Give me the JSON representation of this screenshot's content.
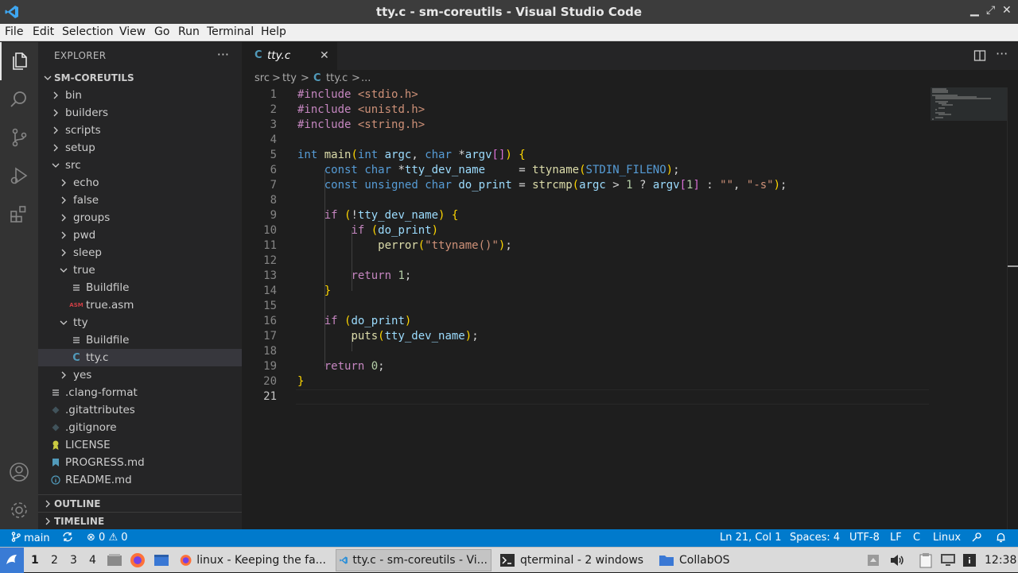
{
  "window": {
    "title": "tty.c - sm-coreutils - Visual Studio Code"
  },
  "menu": [
    "File",
    "Edit",
    "Selection",
    "View",
    "Go",
    "Run",
    "Terminal",
    "Help"
  ],
  "sidebar": {
    "header": "EXPLORER",
    "more": "···",
    "project": "SM-COREUTILS",
    "tree": [
      {
        "label": "bin",
        "kind": "folder",
        "expanded": false,
        "depth": 0
      },
      {
        "label": "builders",
        "kind": "folder",
        "expanded": false,
        "depth": 0
      },
      {
        "label": "scripts",
        "kind": "folder",
        "expanded": false,
        "depth": 0
      },
      {
        "label": "setup",
        "kind": "folder",
        "expanded": false,
        "depth": 0
      },
      {
        "label": "src",
        "kind": "folder",
        "expanded": true,
        "depth": 0
      },
      {
        "label": "echo",
        "kind": "folder",
        "expanded": false,
        "depth": 1
      },
      {
        "label": "false",
        "kind": "folder",
        "expanded": false,
        "depth": 1
      },
      {
        "label": "groups",
        "kind": "folder",
        "expanded": false,
        "depth": 1
      },
      {
        "label": "pwd",
        "kind": "folder",
        "expanded": false,
        "depth": 1
      },
      {
        "label": "sleep",
        "kind": "folder",
        "expanded": false,
        "depth": 1
      },
      {
        "label": "true",
        "kind": "folder",
        "expanded": true,
        "depth": 1
      },
      {
        "label": "Buildfile",
        "kind": "file-lines",
        "depth": 2
      },
      {
        "label": "true.asm",
        "kind": "file-asm",
        "depth": 2
      },
      {
        "label": "tty",
        "kind": "folder",
        "expanded": true,
        "depth": 1
      },
      {
        "label": "Buildfile",
        "kind": "file-lines",
        "depth": 2
      },
      {
        "label": "tty.c",
        "kind": "file-c",
        "depth": 2,
        "selected": true
      },
      {
        "label": "yes",
        "kind": "folder",
        "expanded": false,
        "depth": 1
      },
      {
        "label": ".clang-format",
        "kind": "file-lines",
        "depth": 0
      },
      {
        "label": ".gitattributes",
        "kind": "file-git",
        "depth": 0
      },
      {
        "label": ".gitignore",
        "kind": "file-git",
        "depth": 0
      },
      {
        "label": "LICENSE",
        "kind": "file-license",
        "depth": 0
      },
      {
        "label": "PROGRESS.md",
        "kind": "file-md",
        "depth": 0
      },
      {
        "label": "README.md",
        "kind": "file-info",
        "depth": 0
      }
    ],
    "outline": "OUTLINE",
    "timeline": "TIMELINE"
  },
  "editor": {
    "tab": {
      "icon": "C",
      "label": "tty.c",
      "close": "✕"
    },
    "breadcrumb": [
      "src",
      ">",
      "tty",
      ">",
      "C",
      "tty.c",
      ">",
      "..."
    ],
    "current_line": 21,
    "lines": [
      "#include <stdio.h>",
      "#include <unistd.h>",
      "#include <string.h>",
      "",
      "int main(int argc, char *argv[]) {",
      "    const char *tty_dev_name     = ttyname(STDIN_FILENO);",
      "    const unsigned char do_print = strcmp(argc > 1 ? argv[1] : \"\", \"-s\");",
      "",
      "    if (!tty_dev_name) {",
      "        if (do_print)",
      "            perror(\"ttyname()\");",
      "",
      "        return 1;",
      "    }",
      "",
      "    if (do_print)",
      "        puts(tty_dev_name);",
      "",
      "    return 0;",
      "}",
      ""
    ]
  },
  "statusbar": {
    "branch": "main",
    "errors": "0",
    "warnings": "0",
    "position": "Ln 21, Col 1",
    "spaces": "Spaces: 4",
    "encoding": "UTF-8",
    "eol": "LF",
    "language": "C",
    "platform": "Linux"
  },
  "taskbar": {
    "desktops": [
      "1",
      "2",
      "3",
      "4"
    ],
    "tasks": [
      {
        "label": "linux - Keeping the fa...",
        "icon": "firefox-icon"
      },
      {
        "label": "tty.c - sm-coreutils - Vi...",
        "icon": "vscode-icon",
        "active": true
      },
      {
        "label": "qterminal - 2 windows",
        "icon": "terminal-icon"
      },
      {
        "label": "CollabOS",
        "icon": "folder-icon"
      }
    ],
    "clock": "12:38"
  },
  "colors": {
    "accent": "#007acc",
    "selection": "#37373d",
    "editor_bg": "#1e1e1e",
    "sidebar_bg": "#252526"
  }
}
